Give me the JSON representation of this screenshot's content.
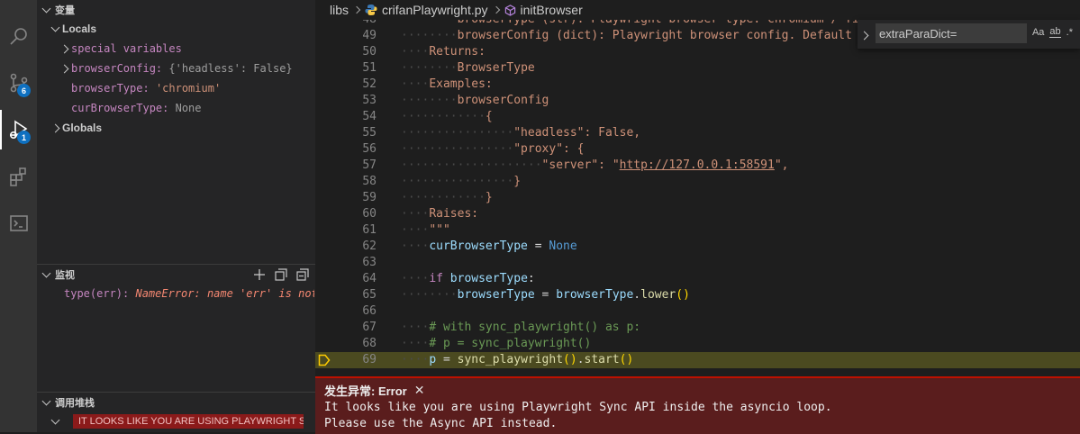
{
  "sidebar": {
    "variables": {
      "title": "变量",
      "locals_label": "Locals",
      "items": [
        {
          "name": "special variables",
          "value": "",
          "expandable": true
        },
        {
          "name": "browserConfig:",
          "value": "{'headless': False}",
          "expandable": true
        },
        {
          "name": "browserType:",
          "value": "'chromium'",
          "expandable": false
        },
        {
          "name": "curBrowserType:",
          "value": "None",
          "expandable": false
        }
      ],
      "globals_label": "Globals"
    },
    "watch": {
      "title": "监视",
      "expr": "type(err):",
      "value": "NameError: name 'err' is not d…"
    },
    "callstack": {
      "title": "调用堆栈",
      "item": "IT LOOKS LIKE YOU ARE USING PLAYWRIGHT S…"
    }
  },
  "activity": {
    "scm_badge": "6",
    "debug_badge": "1"
  },
  "breadcrumb": {
    "folder": "libs",
    "file": "crifanPlaywright.py",
    "symbol": "initBrowser"
  },
  "find": {
    "value": "extraParaDict=",
    "opt_case": "Aa",
    "opt_word": "ab",
    "opt_regex": ".*"
  },
  "editor": {
    "lines": [
      {
        "n": "48",
        "indent": 2,
        "parts": [
          [
            "doc",
            "browserType (str): Playwright browser type: chromium / firefox / w"
          ]
        ]
      },
      {
        "n": "49",
        "indent": 2,
        "parts": [
          [
            "doc",
            "browserConfig (dict): Playwright browser config. Default is {\"head"
          ]
        ]
      },
      {
        "n": "50",
        "indent": 1,
        "parts": [
          [
            "doc",
            "Returns:"
          ]
        ]
      },
      {
        "n": "51",
        "indent": 2,
        "parts": [
          [
            "doc",
            "BrowserType"
          ]
        ]
      },
      {
        "n": "52",
        "indent": 1,
        "parts": [
          [
            "doc",
            "Examples:"
          ]
        ]
      },
      {
        "n": "53",
        "indent": 2,
        "parts": [
          [
            "doc",
            "browserConfig"
          ]
        ]
      },
      {
        "n": "54",
        "indent": 3,
        "parts": [
          [
            "doc",
            "{"
          ]
        ]
      },
      {
        "n": "55",
        "indent": 4,
        "parts": [
          [
            "doc",
            "\"headless\": False,"
          ]
        ]
      },
      {
        "n": "56",
        "indent": 4,
        "parts": [
          [
            "doc",
            "\"proxy\": {"
          ]
        ]
      },
      {
        "n": "57",
        "indent": 5,
        "parts": [
          [
            "doc",
            "\"server\": \""
          ],
          [
            "url",
            "http://127.0.0.1:58591"
          ],
          [
            "doc",
            "\","
          ]
        ]
      },
      {
        "n": "58",
        "indent": 4,
        "parts": [
          [
            "doc",
            "}"
          ]
        ]
      },
      {
        "n": "59",
        "indent": 3,
        "parts": [
          [
            "doc",
            "}"
          ]
        ]
      },
      {
        "n": "60",
        "indent": 1,
        "parts": [
          [
            "doc",
            "Raises:"
          ]
        ]
      },
      {
        "n": "61",
        "indent": 1,
        "parts": [
          [
            "doc",
            "\"\"\""
          ]
        ]
      },
      {
        "n": "62",
        "indent": 1,
        "parts": [
          [
            "var",
            "curBrowserType"
          ],
          [
            "txt",
            " = "
          ],
          [
            "none",
            "None"
          ]
        ]
      },
      {
        "n": "63",
        "indent": 0,
        "parts": []
      },
      {
        "n": "64",
        "indent": 1,
        "parts": [
          [
            "kw",
            "if"
          ],
          [
            "txt",
            " "
          ],
          [
            "var",
            "browserType"
          ],
          [
            "txt",
            ":"
          ]
        ]
      },
      {
        "n": "65",
        "indent": 2,
        "parts": [
          [
            "var",
            "browserType"
          ],
          [
            "txt",
            " = "
          ],
          [
            "var",
            "browserType"
          ],
          [
            "txt",
            "."
          ],
          [
            "fn",
            "lower"
          ],
          [
            "par",
            "()"
          ]
        ]
      },
      {
        "n": "66",
        "indent": 0,
        "parts": []
      },
      {
        "n": "67",
        "indent": 1,
        "parts": [
          [
            "com",
            "# with sync_playwright() as p:"
          ]
        ]
      },
      {
        "n": "68",
        "indent": 1,
        "parts": [
          [
            "com",
            "# p = sync_playwright()"
          ]
        ]
      },
      {
        "n": "69",
        "indent": 1,
        "highlight": true,
        "parts": [
          [
            "var",
            "p"
          ],
          [
            "txt",
            " = "
          ],
          [
            "fn",
            "sync_playwright"
          ],
          [
            "par",
            "()"
          ],
          [
            "txt",
            "."
          ],
          [
            "fn",
            "start"
          ],
          [
            "par",
            "()"
          ]
        ]
      }
    ]
  },
  "exception": {
    "title": "发生异常: Error",
    "line1": "It looks like you are using Playwright Sync API inside the asyncio loop.",
    "line2": "Please use the Async API instead."
  },
  "colors": {
    "highlight": "#4b4a20",
    "exception_bg": "#5a1d1d",
    "badge": "#0e70c0"
  }
}
